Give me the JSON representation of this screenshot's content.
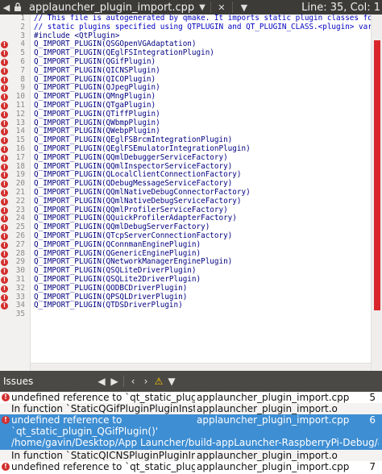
{
  "toolbar": {
    "filename": "applauncher_plugin_import.cpp",
    "position": "Line: 35, Col: 1"
  },
  "editor": {
    "lines": [
      {
        "n": "1",
        "text": "// This file is autogenerated by qmake. It imports static plugin classes for",
        "kind": "comment",
        "error": false
      },
      {
        "n": "2",
        "text": "// static plugins specified using QTPLUGIN and QT_PLUGIN_CLASS.<plugin> variable",
        "kind": "comment",
        "error": false
      },
      {
        "n": "3",
        "text": "#include <QtPlugin>",
        "kind": "preproc",
        "error": false
      },
      {
        "n": "4",
        "text": "Q_IMPORT_PLUGIN(QSGOpenVGAdaptation)",
        "kind": "code",
        "error": true
      },
      {
        "n": "5",
        "text": "Q_IMPORT_PLUGIN(QEglFSIntegrationPlugin)",
        "kind": "code",
        "error": true
      },
      {
        "n": "6",
        "text": "Q_IMPORT_PLUGIN(QGifPlugin)",
        "kind": "code",
        "error": true
      },
      {
        "n": "7",
        "text": "Q_IMPORT_PLUGIN(QICNSPlugin)",
        "kind": "code",
        "error": true
      },
      {
        "n": "8",
        "text": "Q_IMPORT_PLUGIN(QICOPlugin)",
        "kind": "code",
        "error": true
      },
      {
        "n": "9",
        "text": "Q_IMPORT_PLUGIN(QJpegPlugin)",
        "kind": "code",
        "error": true
      },
      {
        "n": "10",
        "text": "Q_IMPORT_PLUGIN(QMngPlugin)",
        "kind": "code",
        "error": true
      },
      {
        "n": "11",
        "text": "Q_IMPORT_PLUGIN(QTgaPlugin)",
        "kind": "code",
        "error": true
      },
      {
        "n": "12",
        "text": "Q_IMPORT_PLUGIN(QTiffPlugin)",
        "kind": "code",
        "error": true
      },
      {
        "n": "13",
        "text": "Q_IMPORT_PLUGIN(QWbmpPlugin)",
        "kind": "code",
        "error": true
      },
      {
        "n": "14",
        "text": "Q_IMPORT_PLUGIN(QWebpPlugin)",
        "kind": "code",
        "error": true
      },
      {
        "n": "15",
        "text": "Q_IMPORT_PLUGIN(QEglFSBrcmIntegrationPlugin)",
        "kind": "code",
        "error": true
      },
      {
        "n": "16",
        "text": "Q_IMPORT_PLUGIN(QEglFSEmulatorIntegrationPlugin)",
        "kind": "code",
        "error": true
      },
      {
        "n": "17",
        "text": "Q_IMPORT_PLUGIN(QQmlDebuggerServiceFactory)",
        "kind": "code",
        "error": true
      },
      {
        "n": "18",
        "text": "Q_IMPORT_PLUGIN(QQmlInspectorServiceFactory)",
        "kind": "code",
        "error": true
      },
      {
        "n": "19",
        "text": "Q_IMPORT_PLUGIN(QLocalClientConnectionFactory)",
        "kind": "code",
        "error": true
      },
      {
        "n": "20",
        "text": "Q_IMPORT_PLUGIN(QDebugMessageServiceFactory)",
        "kind": "code",
        "error": true
      },
      {
        "n": "21",
        "text": "Q_IMPORT_PLUGIN(QQmlNativeDebugConnectorFactory)",
        "kind": "code",
        "error": true
      },
      {
        "n": "22",
        "text": "Q_IMPORT_PLUGIN(QQmlNativeDebugServiceFactory)",
        "kind": "code",
        "error": true
      },
      {
        "n": "23",
        "text": "Q_IMPORT_PLUGIN(QQmlProfilerServiceFactory)",
        "kind": "code",
        "error": true
      },
      {
        "n": "24",
        "text": "Q_IMPORT_PLUGIN(QQuickProfilerAdapterFactory)",
        "kind": "code",
        "error": true
      },
      {
        "n": "25",
        "text": "Q_IMPORT_PLUGIN(QQmlDebugServerFactory)",
        "kind": "code",
        "error": true
      },
      {
        "n": "26",
        "text": "Q_IMPORT_PLUGIN(QTcpServerConnectionFactory)",
        "kind": "code",
        "error": true
      },
      {
        "n": "27",
        "text": "Q_IMPORT_PLUGIN(QConnmanEnginePlugin)",
        "kind": "code",
        "error": true
      },
      {
        "n": "28",
        "text": "Q_IMPORT_PLUGIN(QGenericEnginePlugin)",
        "kind": "code",
        "error": true
      },
      {
        "n": "29",
        "text": "Q_IMPORT_PLUGIN(QNetworkManagerEnginePlugin)",
        "kind": "code",
        "error": true
      },
      {
        "n": "30",
        "text": "Q_IMPORT_PLUGIN(QSQLiteDriverPlugin)",
        "kind": "code",
        "error": true
      },
      {
        "n": "31",
        "text": "Q_IMPORT_PLUGIN(QSQLite2DriverPlugin)",
        "kind": "code",
        "error": true
      },
      {
        "n": "32",
        "text": "Q_IMPORT_PLUGIN(QODBCDriverPlugin)",
        "kind": "code",
        "error": true
      },
      {
        "n": "33",
        "text": "Q_IMPORT_PLUGIN(QPSQLDriverPlugin)",
        "kind": "code",
        "error": true
      },
      {
        "n": "34",
        "text": "Q_IMPORT_PLUGIN(QTDSDriverPlugin)",
        "kind": "code",
        "error": true
      },
      {
        "n": "35",
        "text": "",
        "kind": "code",
        "error": false
      }
    ]
  },
  "issues_pane": {
    "title": "Issues",
    "items": [
      {
        "message": "undefined reference to `qt_static_plugin_Q",
        "file": "applauncher_plugin_import.cpp",
        "line": "5",
        "error": true,
        "selected": false,
        "alt": false
      },
      {
        "message": "In function `StaticQGifPluginPluginInstance",
        "file": "applauncher_plugin_import.o",
        "line": "",
        "error": false,
        "selected": false,
        "alt": true
      },
      {
        "message": "undefined reference to",
        "message2": "`qt_static_plugin_QGifPlugin()'",
        "file": "applauncher_plugin_import.cpp",
        "line": "6",
        "path": "/home/gavin/Desktop/App Launcher/build-appLauncher-RaspberryPi-Debug/applauncher",
        "error": true,
        "selected": true,
        "alt": false
      },
      {
        "message": "In function `StaticQICNSPluginPluginInstanc",
        "file": "applauncher_plugin_import.o",
        "line": "",
        "error": false,
        "selected": false,
        "alt": true
      },
      {
        "message": "undefined reference to `qt_static_plugin_Q",
        "file": "applauncher_plugin_import.cpp",
        "line": "7",
        "error": true,
        "selected": false,
        "alt": false
      }
    ]
  },
  "colors": {
    "error": "#d32f2f",
    "selection": "#3e8ed3",
    "comment": "#0000c0",
    "toolbar_bg": "#3c3b37"
  }
}
